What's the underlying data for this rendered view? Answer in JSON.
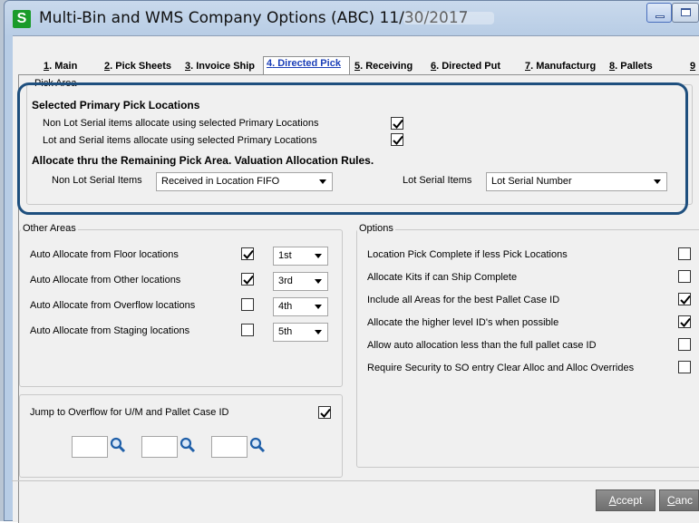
{
  "window": {
    "app_icon_letter": "S",
    "title": "Multi-Bin and WMS Company Options (ABC) 11/30/2017"
  },
  "tabs": [
    {
      "key": "1",
      "label": ". Main"
    },
    {
      "key": "2",
      "label": ". Pick Sheets"
    },
    {
      "key": "3",
      "label": ". Invoice Ship"
    },
    {
      "key": "4",
      "label": ". Directed Pick"
    },
    {
      "key": "5",
      "label": ". Receiving"
    },
    {
      "key": "6",
      "label": ". Directed Put"
    },
    {
      "key": "7",
      "label": ". Manufacturg"
    },
    {
      "key": "8",
      "label": ". Pallets"
    },
    {
      "key": "9",
      "label": ""
    }
  ],
  "active_tab": "4. Directed Pick",
  "pick_area": {
    "title": "Pick Area",
    "heading_primary": "Selected Primary Pick Locations",
    "non_lot_label": "Non Lot Serial items allocate using selected Primary Locations",
    "non_lot_checked": true,
    "lot_label": "Lot and Serial items allocate using selected Primary Locations",
    "lot_checked": true,
    "heading_remaining": "Allocate thru the Remaining Pick Area.  Valuation Allocation Rules.",
    "non_lot_items_label": "Non Lot Serial Items",
    "non_lot_items_value": "Received in Location FIFO",
    "lot_items_label": "Lot Serial Items",
    "lot_items_value": "Lot Serial Number"
  },
  "other_areas": {
    "title": "Other Areas",
    "rows": [
      {
        "label": "Auto Allocate from Floor locations",
        "checked": true,
        "order": "1st"
      },
      {
        "label": "Auto Allocate from Other locations",
        "checked": true,
        "order": "3rd"
      },
      {
        "label": "Auto Allocate from Overflow locations",
        "checked": false,
        "order": "4th"
      },
      {
        "label": "Auto Allocate from Staging locations",
        "checked": false,
        "order": "5th"
      }
    ]
  },
  "jump": {
    "label": "Jump to Overflow for U/M and Pallet Case ID",
    "checked": true
  },
  "options": {
    "title": "Options",
    "rows": [
      {
        "label": "Location Pick Complete if less Pick Locations",
        "checked": false
      },
      {
        "label": "Allocate Kits if can Ship Complete",
        "checked": false
      },
      {
        "label": "Include all Areas for the best Pallet Case ID",
        "checked": true
      },
      {
        "label": "Allocate the higher level ID's when possible",
        "checked": true
      },
      {
        "label": "Allow auto allocation less than the full pallet case ID",
        "checked": false
      },
      {
        "label": "Require Security to SO entry Clear Alloc and Alloc Overrides",
        "checked": false
      }
    ]
  },
  "buttons": {
    "accept_key": "A",
    "accept_rest": "ccept",
    "cancel_key": "C",
    "cancel_rest": "anc"
  },
  "colors": {
    "highlight_border": "#1e4f7e",
    "active_tab_text": "#1b3fb8",
    "app_icon_bg": "#1a9b2a",
    "lookup_icon": "#1f5fa8"
  }
}
